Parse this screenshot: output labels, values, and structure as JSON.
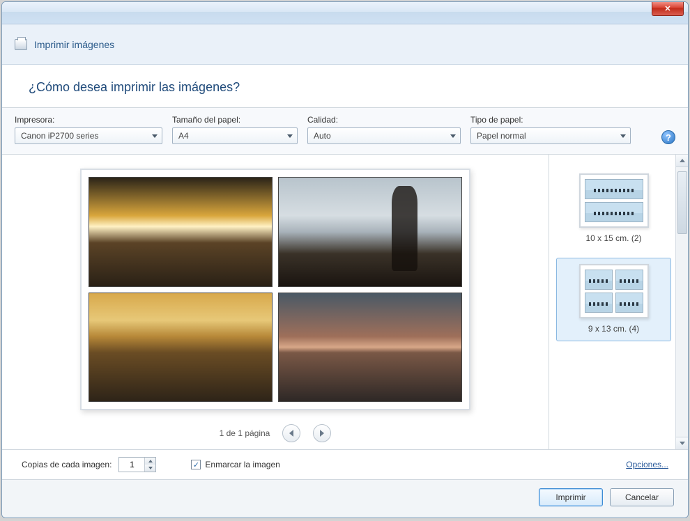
{
  "window": {
    "title": "Imprimir imágenes",
    "close_glyph": "✕"
  },
  "subheader": "¿Cómo desea imprimir las imágenes?",
  "options": {
    "printer_label": "Impresora:",
    "printer_value": "Canon iP2700 series",
    "papersize_label": "Tamaño del papel:",
    "papersize_value": "A4",
    "quality_label": "Calidad:",
    "quality_value": "Auto",
    "papertype_label": "Tipo de papel:",
    "papertype_value": "Papel normal",
    "help_glyph": "?"
  },
  "paginator": {
    "text": "1 de 1 página"
  },
  "layouts": {
    "top_caption": "",
    "items": [
      {
        "label": "10 x 15 cm. (2)",
        "selected": false,
        "grid": "two"
      },
      {
        "label": "9 x 13 cm. (4)",
        "selected": true,
        "grid": "four"
      }
    ]
  },
  "footer": {
    "copies_label": "Copias de cada imagen:",
    "copies_value": "1",
    "fit_checkbox_label": "Enmarcar la imagen",
    "fit_checked": true,
    "options_link": "Opciones..."
  },
  "buttons": {
    "print": "Imprimir",
    "cancel": "Cancelar"
  }
}
